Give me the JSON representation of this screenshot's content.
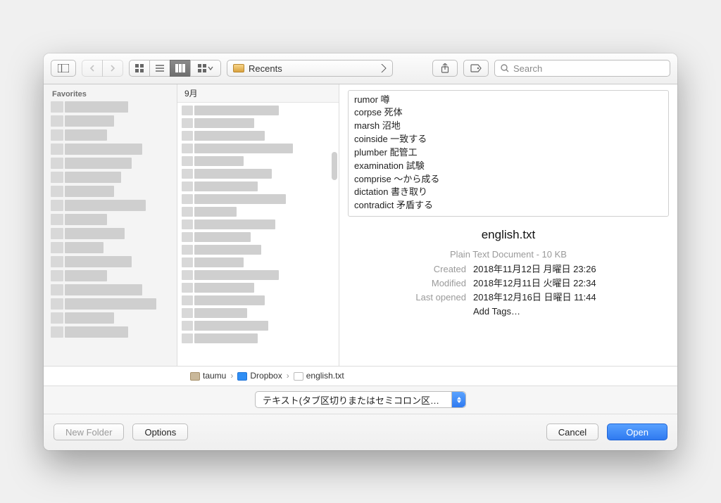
{
  "toolbar": {
    "location_label": "Recents",
    "search_placeholder": "Search"
  },
  "sidebar": {
    "header": "Favorites"
  },
  "column": {
    "header": "9月"
  },
  "preview": {
    "lines": [
      "rumor 噂",
      "corpse 死体",
      "marsh 沼地",
      "coinside 一致する",
      "plumber 配管工",
      "examination 試験",
      "comprise 〜から成る",
      "dictation 書き取り",
      "contradict 矛盾する"
    ],
    "filename": "english.txt",
    "kind": "Plain Text Document - 10 KB",
    "created_label": "Created",
    "created_value": "2018年11月12日 月曜日 23:26",
    "modified_label": "Modified",
    "modified_value": "2018年12月11日 火曜日 22:34",
    "lastopened_label": "Last opened",
    "lastopened_value": "2018年12月16日 日曜日 11:44",
    "add_tags": "Add Tags…"
  },
  "path": {
    "seg0": "taumu",
    "seg1": "Dropbox",
    "seg2": "english.txt"
  },
  "format": {
    "selected": "テキスト(タブ区切りまたはセミコロン区…"
  },
  "footer": {
    "new_folder": "New Folder",
    "options": "Options",
    "cancel": "Cancel",
    "open": "Open"
  }
}
